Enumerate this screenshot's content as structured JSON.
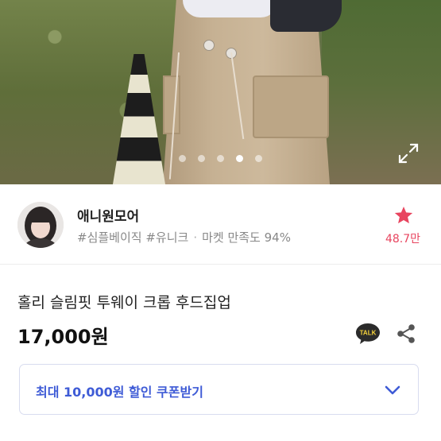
{
  "gallery": {
    "slide_count": 5,
    "active_index": 3,
    "expand_icon": "expand-icon"
  },
  "seller": {
    "name": "애니원모어",
    "tags": "#심플베이직 #유니크",
    "separator": "·",
    "satisfaction": "마켓 만족도 94%",
    "like_count": "48.7만",
    "like_icon": "star-icon",
    "accent_color": "#e8455f"
  },
  "product": {
    "title": "홀리 슬림핏 투웨이 크롭 후드집업",
    "price": "17,000원",
    "talk_label": "TALK",
    "share_icon": "share-icon"
  },
  "coupon": {
    "label": "최대 10,000원 할인 쿠폰받기",
    "color": "#3e5bd6",
    "chevron_icon": "chevron-down-icon"
  }
}
